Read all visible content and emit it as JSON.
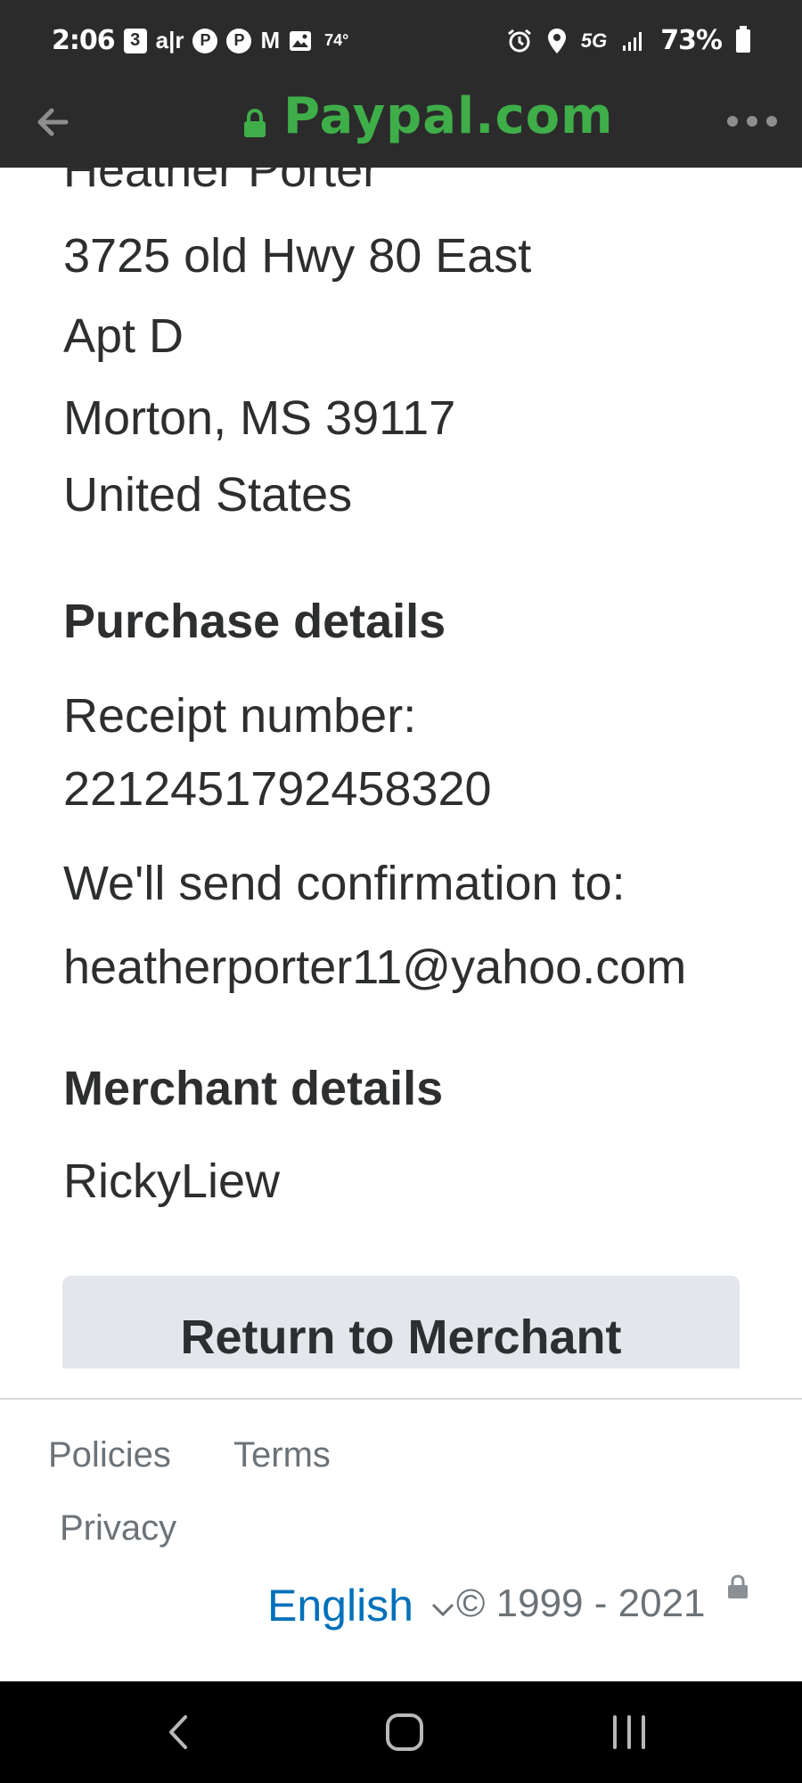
{
  "status_bar": {
    "time": "2:06",
    "notification_icons": [
      "weather-3-icon",
      "air-icon",
      "pinterest-icon",
      "pinterest-icon",
      "gmail-icon",
      "gallery-icon"
    ],
    "weather_badge": "3",
    "air_label": "a|r",
    "pinterest_label": "P",
    "gmail_label": "M",
    "temperature": "74°",
    "network": "5G",
    "battery": "73%"
  },
  "url_bar": {
    "url": "Paypal.com",
    "url_color": "#3fae49"
  },
  "shipping_address": {
    "name": "Heather Porter",
    "line1": "3725 old Hwy 80 East",
    "line2": "Apt D",
    "city_state_zip": "Morton, MS 39117",
    "country": "United States"
  },
  "purchase_details": {
    "heading": "Purchase details",
    "receipt_label": "Receipt number:",
    "receipt_number": "2212451792458320",
    "confirmation_label": "We'll send confirmation to:",
    "email": "heatherporter11@yahoo.com"
  },
  "merchant_details": {
    "heading": "Merchant details",
    "merchant_name": "RickyLiew"
  },
  "return_button": {
    "label": "Return to Merchant"
  },
  "footer": {
    "policies": "Policies",
    "terms": "Terms",
    "privacy": "Privacy",
    "language": "English",
    "copyright": "© 1999 - 2021",
    "link_color": "#0070ba"
  }
}
